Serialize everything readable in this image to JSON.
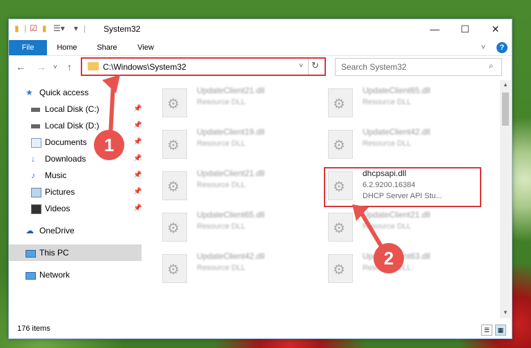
{
  "window": {
    "title": "System32",
    "controls": {
      "minimize": "—",
      "maximize": "☐",
      "close": "✕"
    }
  },
  "ribbon": {
    "tabs": [
      {
        "label": "File"
      },
      {
        "label": "Home"
      },
      {
        "label": "Share"
      },
      {
        "label": "View"
      }
    ],
    "help": "?"
  },
  "nav": {
    "address": "C:\\Windows\\System32",
    "search_placeholder": "Search System32"
  },
  "sidebar": {
    "items": [
      {
        "label": "Quick access",
        "icon": "star-icon"
      },
      {
        "label": "Local Disk (C:)",
        "icon": "drive-icon",
        "pinned": true
      },
      {
        "label": "Local Disk (D:)",
        "icon": "drive-icon",
        "pinned": true
      },
      {
        "label": "Documents",
        "icon": "documents-icon",
        "pinned": true
      },
      {
        "label": "Downloads",
        "icon": "download-icon",
        "pinned": true
      },
      {
        "label": "Music",
        "icon": "music-icon",
        "pinned": true
      },
      {
        "label": "Pictures",
        "icon": "pictures-icon",
        "pinned": true
      },
      {
        "label": "Videos",
        "icon": "videos-icon",
        "pinned": true
      },
      {
        "label": "OneDrive",
        "icon": "cloud-icon"
      },
      {
        "label": "This PC",
        "icon": "computer-icon",
        "selected": true
      },
      {
        "label": "Network",
        "icon": "network-icon"
      }
    ]
  },
  "files": [
    {
      "name": "UpdateClient21.dll",
      "type": "Resource DLL"
    },
    {
      "name": "UpdateClient65.dll",
      "type": "Resource DLL"
    },
    {
      "name": "UpdateClient19.dll",
      "type": "Resource DLL"
    },
    {
      "name": "UpdateClient42.dll",
      "type": "Resource DLL"
    },
    {
      "name": "UpdateClient21.dll",
      "type": "Resource DLL"
    },
    {
      "name": "dhcpsapi.dll",
      "version": "6.2.9200.16384",
      "type": "DHCP Server API Stu..."
    },
    {
      "name": "UpdateClient65.dll",
      "type": "Resource DLL"
    },
    {
      "name": "UpdateClient21.dll",
      "type": "Resource DLL"
    },
    {
      "name": "UpdateClient42.dll",
      "type": "Resource DLL"
    },
    {
      "name": "UpdateClient63.dll",
      "type": "Resource DLL"
    }
  ],
  "status": {
    "count": "176 items"
  },
  "annotations": {
    "step1": "1",
    "step2": "2",
    "color": "#e8534f"
  }
}
